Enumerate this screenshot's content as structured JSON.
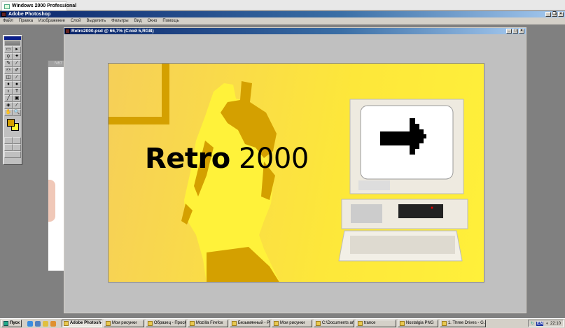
{
  "browser": {
    "tab_title": "Windows 2000 Professional",
    "close": "×"
  },
  "app": {
    "title": "Adobe Photoshop"
  },
  "menu": [
    "Файл",
    "Правка",
    "Изображение",
    "Слой",
    "Выделить",
    "Фильтры",
    "Вид",
    "Окно",
    "Помощь"
  ],
  "window_buttons": {
    "minimize": "_",
    "maximize": "□",
    "restore": "❐",
    "close": "×"
  },
  "back_document": {
    "title": "N67"
  },
  "document": {
    "title": "Retro2000.psd @ 66,7% (Слой 5,RGB)",
    "zoom": "66,7%"
  },
  "canvas": {
    "headline_bold": "Retro",
    "headline_regular": "2000"
  },
  "colors": {
    "foreground": "#d4a000",
    "background": "#fff830",
    "title_bar": "#0a246a"
  },
  "tools": [
    "▭",
    "▸",
    "ϙ",
    "✦",
    "✎",
    "⁄",
    "⚇",
    "✐",
    "◫",
    "∕",
    "♦",
    "●",
    "♁",
    "T",
    "╱",
    "▣",
    "◈",
    "⁄",
    "✋",
    "🔍"
  ],
  "taskbar": {
    "start": "Пуск",
    "items": [
      {
        "label": "Adobe Photoshop",
        "active": true
      },
      {
        "label": "Мои рисунки"
      },
      {
        "label": "Образец - Просм..."
      },
      {
        "label": "Mozilla Firefox"
      },
      {
        "label": "Безымянный - Paint"
      },
      {
        "label": "Мои рисунки"
      },
      {
        "label": "C:\\Documents and..."
      },
      {
        "label": "trance"
      },
      {
        "label": "Nostalgia PNG"
      },
      {
        "label": "1. Three Drives - G..."
      }
    ],
    "language": "EN",
    "clock": "22:10"
  }
}
